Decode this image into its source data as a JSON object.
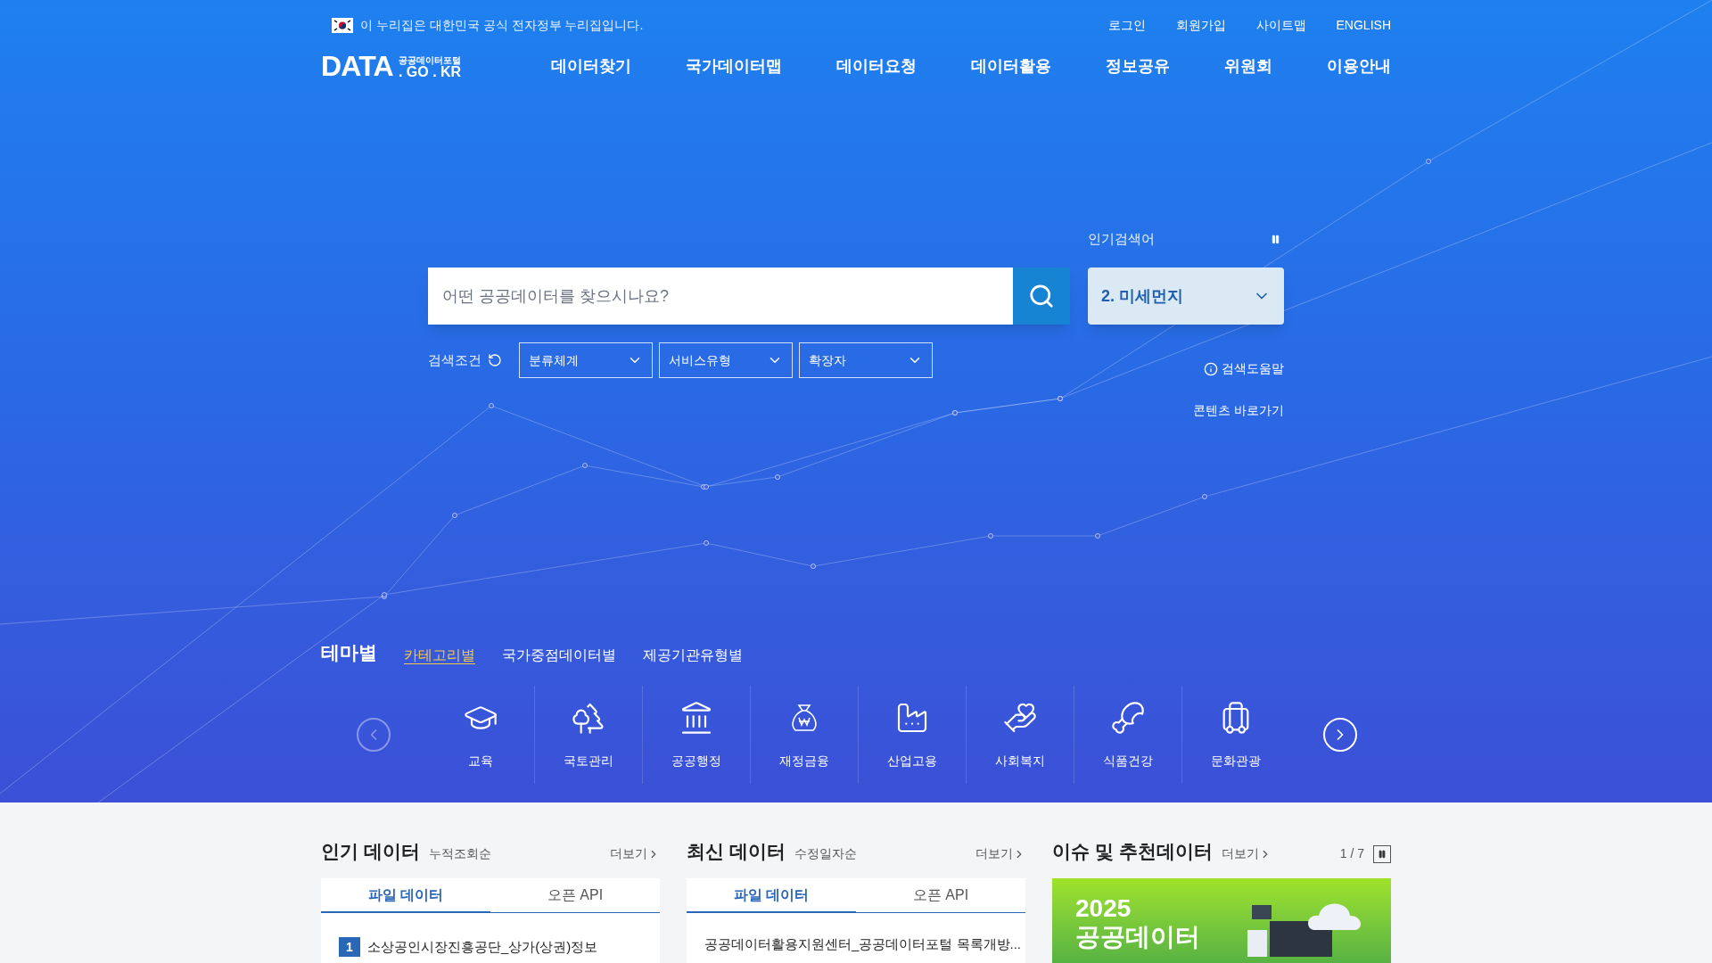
{
  "gov_banner": {
    "text": "이 누리집은 대한민국 공식 전자정부 누리집입니다."
  },
  "top_links": [
    "로그인",
    "회원가입",
    "사이트맵",
    "ENGLISH"
  ],
  "logo": {
    "main": "DATA",
    "sub": "공공데이터포털",
    "domain": ". GO . KR"
  },
  "nav": [
    "데이터찾기",
    "국가데이터맵",
    "데이터요청",
    "데이터활용",
    "정보공유",
    "위원회",
    "이용안내"
  ],
  "search": {
    "placeholder": "어떤 공공데이터를 찾으시나요?"
  },
  "popular": {
    "label": "인기검색어",
    "current": "2. 미세먼지"
  },
  "filters": {
    "label": "검색조건",
    "selects": [
      "분류체계",
      "서비스유형",
      "확장자"
    ]
  },
  "help_link": "검색도움말",
  "contents_link": "콘텐츠 바로가기",
  "theme": {
    "title": "테마별",
    "tabs": [
      {
        "label": "카테고리별",
        "selected": true
      },
      {
        "label": "국가중점데이터별",
        "selected": false
      },
      {
        "label": "제공기관유형별",
        "selected": false
      }
    ],
    "prev_disabled": true,
    "next_disabled": false,
    "categories": [
      {
        "label": "교육",
        "kind": "education"
      },
      {
        "label": "국토관리",
        "kind": "land"
      },
      {
        "label": "공공행정",
        "kind": "admin"
      },
      {
        "label": "재정금융",
        "kind": "finance"
      },
      {
        "label": "산업고용",
        "kind": "industry"
      },
      {
        "label": "사회복지",
        "kind": "welfare"
      },
      {
        "label": "식품건강",
        "kind": "food"
      },
      {
        "label": "문화관광",
        "kind": "tourism"
      }
    ]
  },
  "panels": [
    {
      "kind": "ranked",
      "title": "인기 데이터",
      "sort": "누적조회순",
      "more": "더보기",
      "tabs": [
        {
          "label": "파일 데이터",
          "selected": true
        },
        {
          "label": "오픈 API",
          "selected": false
        }
      ],
      "items": [
        {
          "rank": "1",
          "text": "소상공인시장진흥공단_상가(상권)정보"
        }
      ]
    },
    {
      "kind": "plain",
      "title": "최신 데이터",
      "sort": "수정일자순",
      "more": "더보기",
      "tabs": [
        {
          "label": "파일 데이터",
          "selected": true
        },
        {
          "label": "오픈 API",
          "selected": false
        }
      ],
      "items": [
        {
          "text": "공공데이터활용지원센터_공공데이터포털 목록개방..."
        }
      ]
    }
  ],
  "issue": {
    "title": "이슈 및 추천데이터",
    "more": "더보기",
    "pager": "1 / 7",
    "banner": {
      "year": "2025",
      "title": "공공데이터"
    }
  }
}
